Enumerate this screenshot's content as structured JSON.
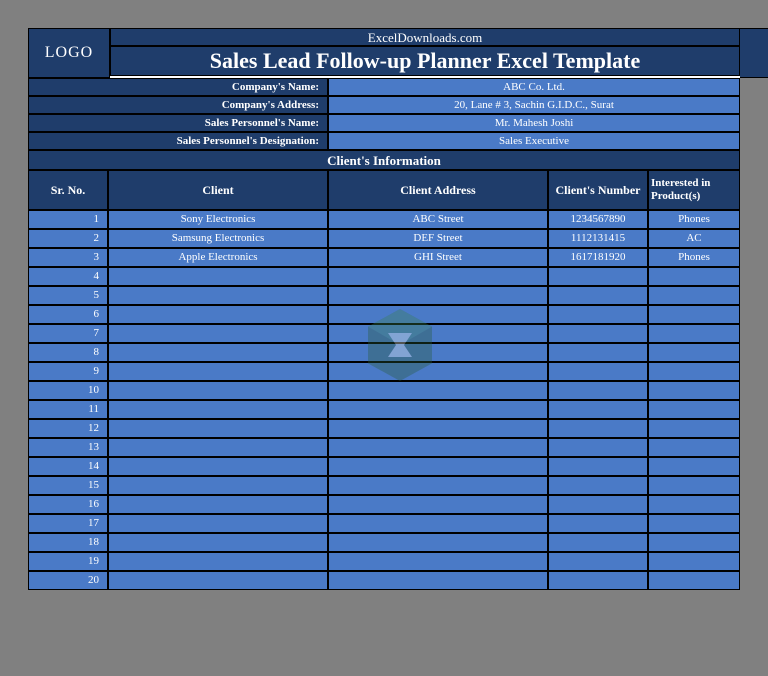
{
  "header": {
    "logo_text": "LOGO",
    "site": "ExcelDownloads.com",
    "title": "Sales Lead Follow-up Planner Excel Template"
  },
  "meta": {
    "labels": {
      "company_name": "Company's Name:",
      "company_address": "Company's Address:",
      "personnel_name": "Sales Personnel's Name:",
      "personnel_designation": "Sales Personnel's Designation:"
    },
    "values": {
      "company_name": "ABC Co. Ltd.",
      "company_address": "20, Lane # 3, Sachin G.I.D.C., Surat",
      "personnel_name": "Mr. Mahesh Joshi",
      "personnel_designation": "Sales Executive"
    }
  },
  "section_header": "Client's Information",
  "columns": {
    "sr": "Sr. No.",
    "client": "Client",
    "address": "Client Address",
    "number": "Client's Number",
    "product": "Interested in Product(s)"
  },
  "rows": [
    {
      "sr": "1",
      "client": "Sony Electronics",
      "address": "ABC Street",
      "number": "1234567890",
      "product": "Phones"
    },
    {
      "sr": "2",
      "client": "Samsung Electronics",
      "address": "DEF Street",
      "number": "1112131415",
      "product": "AC"
    },
    {
      "sr": "3",
      "client": "Apple Electronics",
      "address": "GHI Street",
      "number": "1617181920",
      "product": "Phones"
    },
    {
      "sr": "4",
      "client": "",
      "address": "",
      "number": "",
      "product": ""
    },
    {
      "sr": "5",
      "client": "",
      "address": "",
      "number": "",
      "product": ""
    },
    {
      "sr": "6",
      "client": "",
      "address": "",
      "number": "",
      "product": ""
    },
    {
      "sr": "7",
      "client": "",
      "address": "",
      "number": "",
      "product": ""
    },
    {
      "sr": "8",
      "client": "",
      "address": "",
      "number": "",
      "product": ""
    },
    {
      "sr": "9",
      "client": "",
      "address": "",
      "number": "",
      "product": ""
    },
    {
      "sr": "10",
      "client": "",
      "address": "",
      "number": "",
      "product": ""
    },
    {
      "sr": "11",
      "client": "",
      "address": "",
      "number": "",
      "product": ""
    },
    {
      "sr": "12",
      "client": "",
      "address": "",
      "number": "",
      "product": ""
    },
    {
      "sr": "13",
      "client": "",
      "address": "",
      "number": "",
      "product": ""
    },
    {
      "sr": "14",
      "client": "",
      "address": "",
      "number": "",
      "product": ""
    },
    {
      "sr": "15",
      "client": "",
      "address": "",
      "number": "",
      "product": ""
    },
    {
      "sr": "16",
      "client": "",
      "address": "",
      "number": "",
      "product": ""
    },
    {
      "sr": "17",
      "client": "",
      "address": "",
      "number": "",
      "product": ""
    },
    {
      "sr": "18",
      "client": "",
      "address": "",
      "number": "",
      "product": ""
    },
    {
      "sr": "19",
      "client": "",
      "address": "",
      "number": "",
      "product": ""
    },
    {
      "sr": "20",
      "client": "",
      "address": "",
      "number": "",
      "product": ""
    }
  ]
}
